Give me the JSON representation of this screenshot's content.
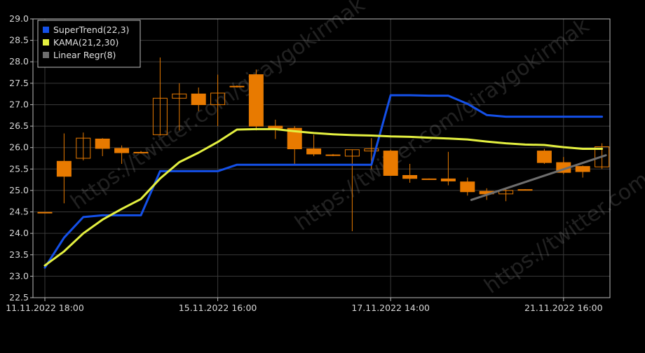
{
  "chart_data": {
    "type": "candlestick",
    "ylim": [
      22.5,
      29.0
    ],
    "y_ticks": [
      "29.0",
      "28.5",
      "28.0",
      "27.5",
      "27.0",
      "26.5",
      "26.0",
      "25.5",
      "25.0",
      "24.5",
      "24.0",
      "23.5",
      "23.0",
      "22.5"
    ],
    "x_ticks": [
      {
        "label": "11.11.2022 18:00",
        "index": 0
      },
      {
        "label": "15.11.2022 16:00",
        "index": 9
      },
      {
        "label": "17.11.2022 14:00",
        "index": 18
      },
      {
        "label": "21.11.2022 16:00",
        "index": 27
      }
    ],
    "grid": true,
    "legend_position": "top-left",
    "colors": {
      "background": "#000000",
      "grid": "#3a3a3a",
      "axis_text": "#d8d8d8",
      "candle_up": "#e87a00",
      "candle_down": "#e87a00",
      "supertrend": "#1450e8",
      "kama": "#e4f040",
      "linreg": "#6e6e6e"
    },
    "legend": [
      {
        "label": "SuperTrend(22,3)",
        "color": "#1450e8"
      },
      {
        "label": "KAMA(21,2,30)",
        "color": "#e4f040"
      },
      {
        "label": "Linear Regr(8)",
        "color": "#6e6e6e"
      }
    ],
    "candles": [
      {
        "o": 24.48,
        "h": 24.5,
        "l": 24.47,
        "c": 24.49
      },
      {
        "o": 25.68,
        "h": 26.33,
        "l": 24.7,
        "c": 25.33
      },
      {
        "o": 25.75,
        "h": 26.35,
        "l": 25.7,
        "c": 26.22
      },
      {
        "o": 26.2,
        "h": 26.22,
        "l": 25.8,
        "c": 25.98
      },
      {
        "o": 25.98,
        "h": 26.05,
        "l": 25.62,
        "c": 25.88
      },
      {
        "o": 25.88,
        "h": 25.92,
        "l": 25.86,
        "c": 25.89
      },
      {
        "o": 26.3,
        "h": 28.1,
        "l": 26.28,
        "c": 27.15
      },
      {
        "o": 27.15,
        "h": 27.5,
        "l": 26.4,
        "c": 27.25
      },
      {
        "o": 27.25,
        "h": 27.4,
        "l": 26.85,
        "c": 27.0
      },
      {
        "o": 27.0,
        "h": 27.7,
        "l": 26.5,
        "c": 27.27
      },
      {
        "o": 27.42,
        "h": 27.45,
        "l": 27.4,
        "c": 27.43
      },
      {
        "o": 27.7,
        "h": 27.82,
        "l": 26.4,
        "c": 26.5
      },
      {
        "o": 26.5,
        "h": 26.65,
        "l": 26.2,
        "c": 26.45
      },
      {
        "o": 26.45,
        "h": 26.5,
        "l": 25.6,
        "c": 25.97
      },
      {
        "o": 25.97,
        "h": 26.3,
        "l": 25.8,
        "c": 25.85
      },
      {
        "o": 25.83,
        "h": 25.85,
        "l": 25.8,
        "c": 25.82
      },
      {
        "o": 25.8,
        "h": 25.95,
        "l": 24.05,
        "c": 25.95
      },
      {
        "o": 25.92,
        "h": 26.22,
        "l": 25.5,
        "c": 25.97
      },
      {
        "o": 25.92,
        "h": 25.95,
        "l": 25.35,
        "c": 25.35
      },
      {
        "o": 25.35,
        "h": 25.62,
        "l": 25.18,
        "c": 25.28
      },
      {
        "o": 25.27,
        "h": 25.28,
        "l": 25.25,
        "c": 25.27
      },
      {
        "o": 25.27,
        "h": 25.9,
        "l": 25.12,
        "c": 25.22
      },
      {
        "o": 25.2,
        "h": 25.3,
        "l": 24.88,
        "c": 24.97
      },
      {
        "o": 24.98,
        "h": 25.05,
        "l": 24.78,
        "c": 24.92
      },
      {
        "o": 24.92,
        "h": 25.02,
        "l": 24.75,
        "c": 25.0
      },
      {
        "o": 25.02,
        "h": 25.03,
        "l": 25.01,
        "c": 25.02
      },
      {
        "o": 25.92,
        "h": 25.97,
        "l": 25.62,
        "c": 25.65
      },
      {
        "o": 25.65,
        "h": 25.78,
        "l": 25.38,
        "c": 25.42
      },
      {
        "o": 25.56,
        "h": 25.58,
        "l": 25.3,
        "c": 25.44
      },
      {
        "o": 25.55,
        "h": 26.1,
        "l": 25.5,
        "c": 26.02
      }
    ],
    "series": [
      {
        "name": "SuperTrend(22,3)",
        "color": "#1450e8",
        "points": [
          [
            0,
            23.2
          ],
          [
            1,
            23.9
          ],
          [
            2,
            24.38
          ],
          [
            3,
            24.42
          ],
          [
            4,
            24.42
          ],
          [
            5,
            24.42
          ],
          [
            6,
            25.45
          ],
          [
            7,
            25.45
          ],
          [
            8,
            25.45
          ],
          [
            9,
            25.45
          ],
          [
            10,
            25.6
          ],
          [
            11,
            25.6
          ],
          [
            12,
            25.6
          ],
          [
            13,
            25.6
          ],
          [
            14,
            25.6
          ],
          [
            15,
            25.6
          ],
          [
            16,
            25.6
          ],
          [
            17,
            25.6
          ],
          [
            18,
            27.22
          ],
          [
            19,
            27.22
          ],
          [
            20,
            27.21
          ],
          [
            21,
            27.21
          ],
          [
            22,
            27.02
          ],
          [
            23,
            26.76
          ],
          [
            24,
            26.72
          ],
          [
            25,
            26.72
          ],
          [
            26,
            26.72
          ],
          [
            27,
            26.72
          ],
          [
            28,
            26.72
          ],
          [
            29,
            26.72
          ]
        ]
      },
      {
        "name": "KAMA(21,2,30)",
        "color": "#e4f040",
        "points": [
          [
            0,
            23.25
          ],
          [
            1,
            23.58
          ],
          [
            2,
            24.0
          ],
          [
            3,
            24.32
          ],
          [
            4,
            24.57
          ],
          [
            5,
            24.8
          ],
          [
            6,
            25.28
          ],
          [
            7,
            25.66
          ],
          [
            8,
            25.88
          ],
          [
            9,
            26.13
          ],
          [
            10,
            26.42
          ],
          [
            11,
            26.43
          ],
          [
            12,
            26.43
          ],
          [
            13,
            26.38
          ],
          [
            14,
            26.34
          ],
          [
            15,
            26.31
          ],
          [
            16,
            26.29
          ],
          [
            17,
            26.28
          ],
          [
            18,
            26.26
          ],
          [
            19,
            26.25
          ],
          [
            20,
            26.23
          ],
          [
            21,
            26.21
          ],
          [
            22,
            26.19
          ],
          [
            23,
            26.14
          ],
          [
            24,
            26.1
          ],
          [
            25,
            26.07
          ],
          [
            26,
            26.06
          ],
          [
            27,
            26.01
          ],
          [
            28,
            25.97
          ],
          [
            29,
            25.97
          ]
        ]
      },
      {
        "name": "Linear Regr(8)",
        "color": "#6e6e6e",
        "points": [
          [
            22.2,
            24.78
          ],
          [
            29.2,
            25.82
          ]
        ]
      }
    ],
    "watermarks": [
      {
        "text": "https://twitter.com/giraygokirmak",
        "rotate": -35
      },
      {
        "text": "https://twitter.com/giraygokirmak",
        "rotate": -35
      },
      {
        "text": "https://twitter.com/giraygokirmak",
        "rotate": -35
      }
    ]
  }
}
